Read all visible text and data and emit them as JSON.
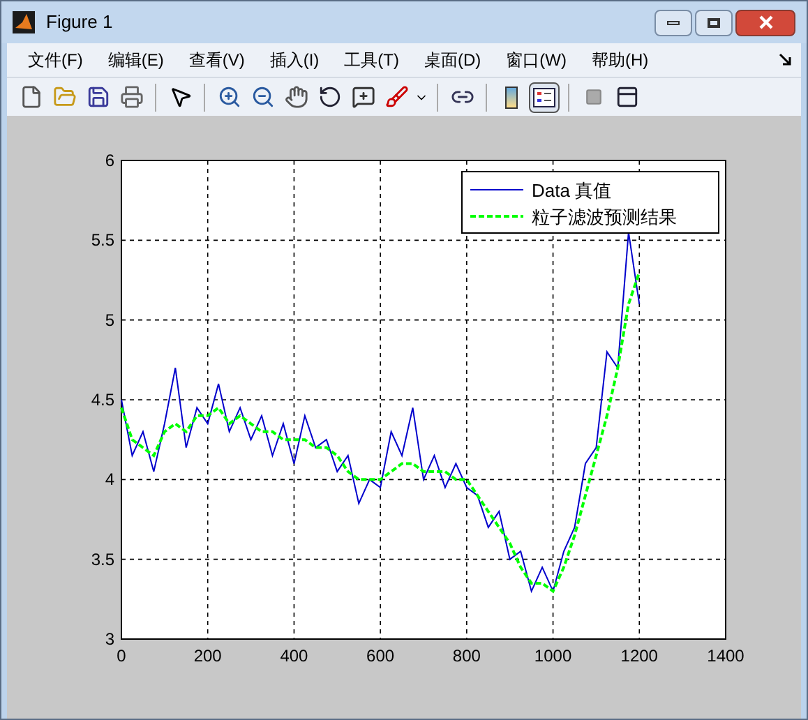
{
  "window": {
    "title": "Figure 1"
  },
  "menu": [
    {
      "label": "文件(F)"
    },
    {
      "label": "编辑(E)"
    },
    {
      "label": "查看(V)"
    },
    {
      "label": "插入(I)"
    },
    {
      "label": "工具(T)"
    },
    {
      "label": "桌面(D)"
    },
    {
      "label": "窗口(W)"
    },
    {
      "label": "帮助(H)"
    }
  ],
  "toolbar": {
    "legend_toggle_selected": true
  },
  "chart_data": {
    "type": "line",
    "x": [
      0,
      25,
      50,
      75,
      100,
      125,
      150,
      175,
      200,
      225,
      250,
      275,
      300,
      325,
      350,
      375,
      400,
      425,
      450,
      475,
      500,
      525,
      550,
      575,
      600,
      625,
      650,
      675,
      700,
      725,
      750,
      775,
      800,
      825,
      850,
      875,
      900,
      925,
      950,
      975,
      1000,
      1025,
      1050,
      1075,
      1100,
      1125,
      1150,
      1175,
      1200
    ],
    "series": [
      {
        "name": "Data 真值",
        "color": "#0000cc",
        "line_style": "solid",
        "values": [
          4.5,
          4.15,
          4.3,
          4.05,
          4.35,
          4.7,
          4.2,
          4.45,
          4.35,
          4.6,
          4.3,
          4.45,
          4.25,
          4.4,
          4.15,
          4.35,
          4.1,
          4.4,
          4.2,
          4.25,
          4.05,
          4.15,
          3.85,
          4.0,
          3.95,
          4.3,
          4.15,
          4.45,
          4.0,
          4.15,
          3.95,
          4.1,
          3.95,
          3.9,
          3.7,
          3.8,
          3.5,
          3.55,
          3.3,
          3.45,
          3.3,
          3.55,
          3.7,
          4.1,
          4.2,
          4.8,
          4.7,
          5.55,
          5.1
        ]
      },
      {
        "name": "粒子滤波预测结果",
        "color": "#00ff00",
        "line_style": "dashed",
        "values": [
          4.45,
          4.25,
          4.2,
          4.15,
          4.3,
          4.35,
          4.3,
          4.4,
          4.4,
          4.45,
          4.35,
          4.4,
          4.35,
          4.3,
          4.3,
          4.25,
          4.25,
          4.25,
          4.2,
          4.2,
          4.15,
          4.05,
          4.0,
          4.0,
          4.0,
          4.05,
          4.1,
          4.1,
          4.05,
          4.05,
          4.05,
          4.0,
          4.0,
          3.9,
          3.8,
          3.7,
          3.6,
          3.45,
          3.35,
          3.35,
          3.3,
          3.45,
          3.65,
          3.9,
          4.15,
          4.4,
          4.7,
          5.1,
          5.3
        ]
      }
    ],
    "xlim": [
      0,
      1400
    ],
    "ylim": [
      3,
      6
    ],
    "xticks": [
      0,
      200,
      400,
      600,
      800,
      1000,
      1200,
      1400
    ],
    "yticks": [
      3,
      3.5,
      4,
      4.5,
      5,
      5.5,
      6
    ],
    "grid": true,
    "legend": true
  }
}
